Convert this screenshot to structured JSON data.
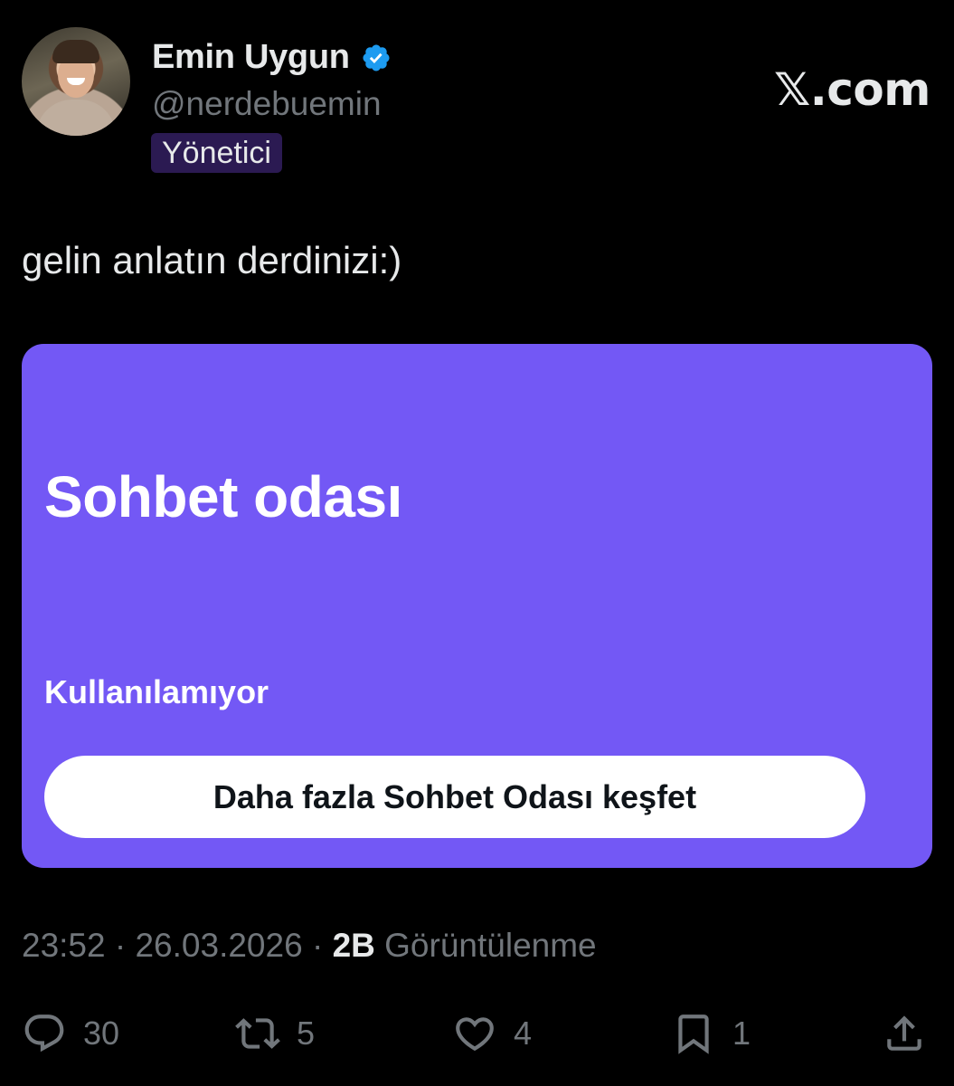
{
  "header": {
    "name": "Emin Uygun",
    "handle": "@nerdebuemin",
    "badge": "Yönetici",
    "site": "𝕏.com",
    "verified_color": "#1d9bf0"
  },
  "tweet": {
    "text": "gelin anlatın derdinizi:)"
  },
  "card": {
    "title": "Sohbet odası",
    "status": "Kullanılamıyor",
    "button_label": "Daha fazla Sohbet Odası keşfet",
    "background_color": "#7358f5"
  },
  "meta": {
    "time": "23:52",
    "sep1": " · ",
    "date": "26.03.2026",
    "sep2": " · ",
    "views_count": "2B",
    "views_label": " Görüntülenme"
  },
  "actions": {
    "replies": "30",
    "retweets": "5",
    "likes": "4",
    "bookmarks": "1"
  }
}
